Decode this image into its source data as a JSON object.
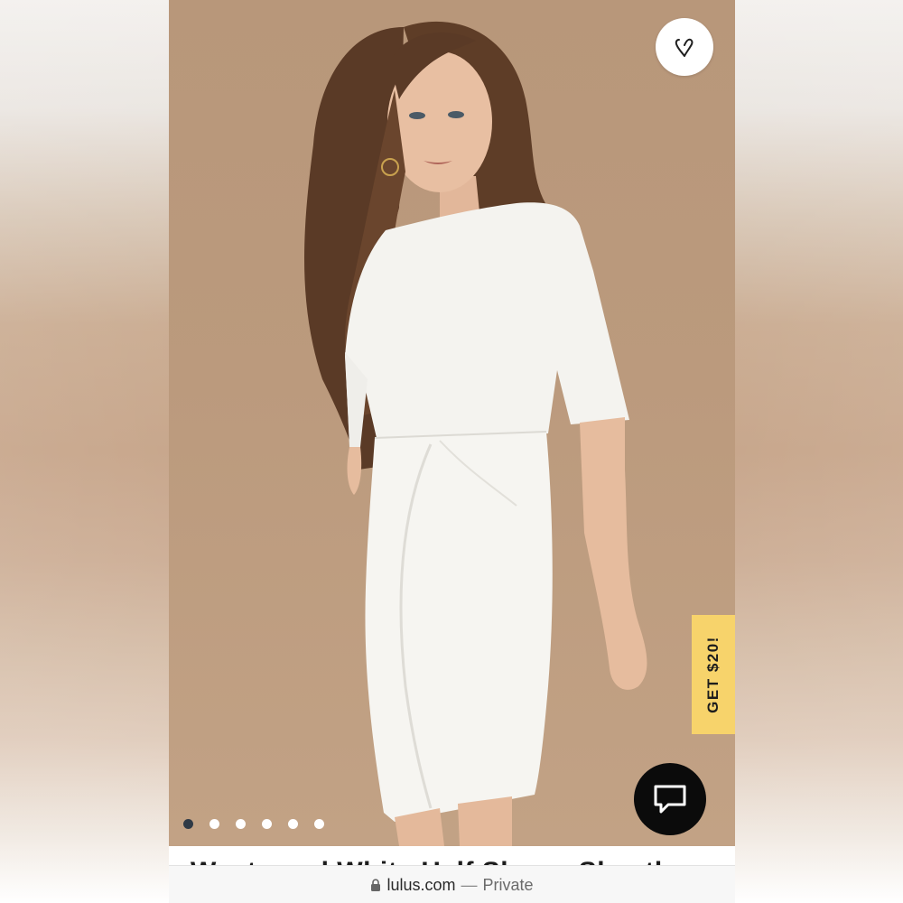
{
  "product": {
    "title": "Westwood White Half Sleeve Sheath",
    "image_alt": "Model wearing a white half sleeve sheath dress",
    "carousel": {
      "total": 6,
      "active_index": 0
    }
  },
  "favorite": {
    "icon": "heart-outline-icon"
  },
  "promo": {
    "label": "GET $20!",
    "color": "#f7d36b"
  },
  "chat": {
    "icon": "chat-bubble-icon"
  },
  "browser": {
    "lock_icon": "lock-icon",
    "domain": "lulus.com",
    "separator": "—",
    "privacy": "Private"
  },
  "colors": {
    "backdrop": "#b8977a",
    "active_dot": "#2f3a46",
    "promo": "#f7d36b"
  }
}
